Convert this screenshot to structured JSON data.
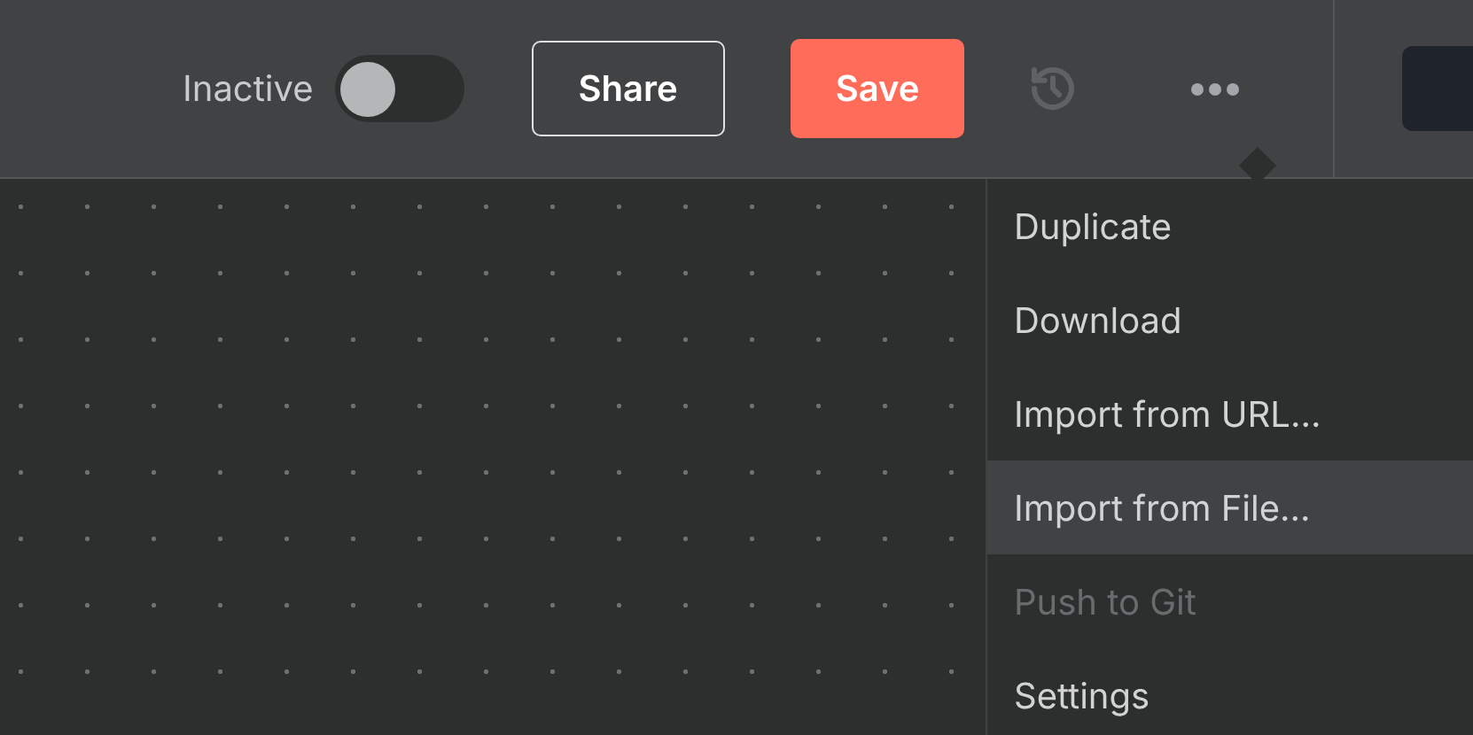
{
  "header": {
    "active_toggle": {
      "label": "Inactive",
      "on": false
    },
    "share_button": "Share",
    "save_button": "Save",
    "history_disabled": true
  },
  "menu": {
    "items": [
      {
        "label": "Duplicate",
        "selected": false,
        "disabled": false
      },
      {
        "label": "Download",
        "selected": false,
        "disabled": false
      },
      {
        "label": "Import from URL...",
        "selected": false,
        "disabled": false
      },
      {
        "label": "Import from File...",
        "selected": true,
        "disabled": false
      },
      {
        "label": "Push to Git",
        "selected": false,
        "disabled": true
      },
      {
        "label": "Settings",
        "selected": false,
        "disabled": false
      }
    ]
  }
}
